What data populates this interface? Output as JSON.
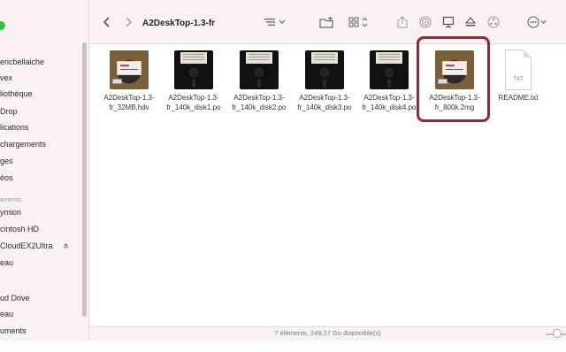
{
  "window": {
    "title": "A2DeskTop-1.3-fr"
  },
  "sidebar": {
    "items": [
      {
        "label": "ericbellaiche"
      },
      {
        "label": "vex"
      },
      {
        "label": "liothèque"
      },
      {
        "label": "Drop"
      },
      {
        "label": "lications"
      },
      {
        "label": "chargements"
      },
      {
        "label": "ges"
      },
      {
        "label": "éos"
      }
    ],
    "section_label": "ements",
    "locations": [
      {
        "label": "ymion"
      },
      {
        "label": "cintosh HD"
      },
      {
        "label": "CloudEX2Ultra"
      },
      {
        "label": "eau"
      }
    ],
    "icloud": [
      {
        "label": "ud Drive"
      },
      {
        "label": "eau"
      },
      {
        "label": "uments"
      }
    ]
  },
  "toolbar": {
    "back_icon": "chevron-left-icon",
    "forward_icon": "chevron-right-icon",
    "list_view_icon": "list-icon",
    "grid_view_icon": "grid-icon",
    "share_icon": "share-icon",
    "airdrop_icon": "airdrop-icon",
    "desktop_icon": "desktop-icon",
    "eject_icon": "eject-icon",
    "network_icon": "network-icon",
    "more_icon": "ellipsis-icon"
  },
  "files": [
    {
      "name": "A2DeskTop-1.3-fr_32MB.hdv",
      "kind": "photo"
    },
    {
      "name": "A2DeskTop-1.3-fr_140k_disk1.po",
      "kind": "disk"
    },
    {
      "name": "A2DeskTop-1.3-fr_140k_disk2.po",
      "kind": "disk"
    },
    {
      "name": "A2DeskTop-1.3-fr_140k_disk3.po",
      "kind": "disk"
    },
    {
      "name": "A2DeskTop-1.3-fr_140k_disk4.po",
      "kind": "disk"
    },
    {
      "name": "A2DeskTop-1.3-fr_800k.2mg",
      "kind": "photo",
      "highlighted": true
    },
    {
      "name": "README.txt",
      "kind": "txt",
      "ext_label": "TXT"
    }
  ],
  "status": {
    "text": "7 éléments, 249,17 Go disponible(s)"
  },
  "colors": {
    "sidebar_bg": "#fbf0f2",
    "highlight": "#a8202e",
    "traffic_green": "#2ac840"
  }
}
